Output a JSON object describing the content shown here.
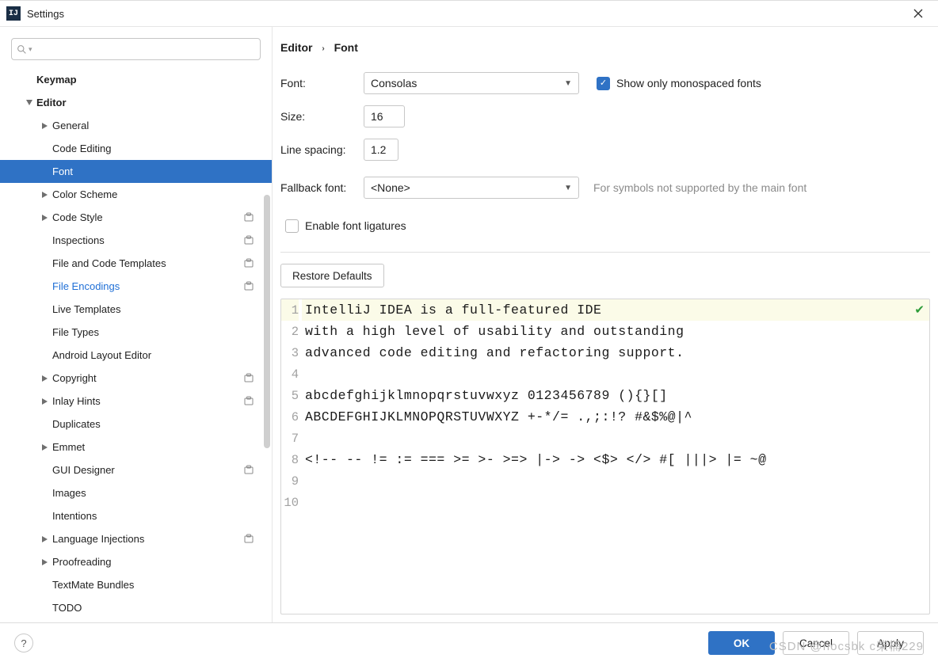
{
  "window_title": "Settings",
  "breadcrumb": {
    "root": "Editor",
    "leaf": "Font"
  },
  "sidebar": {
    "items": [
      {
        "label": "Keymap",
        "level": 0,
        "bold": true,
        "expand": null,
        "selected": false,
        "modified": false,
        "badge": false
      },
      {
        "label": "Editor",
        "level": 0,
        "bold": true,
        "expand": "down",
        "selected": false,
        "modified": false,
        "badge": false
      },
      {
        "label": "General",
        "level": 1,
        "bold": false,
        "expand": "right",
        "selected": false,
        "modified": false,
        "badge": false
      },
      {
        "label": "Code Editing",
        "level": 1,
        "bold": false,
        "expand": null,
        "selected": false,
        "modified": false,
        "badge": false
      },
      {
        "label": "Font",
        "level": 1,
        "bold": false,
        "expand": null,
        "selected": true,
        "modified": false,
        "badge": false
      },
      {
        "label": "Color Scheme",
        "level": 1,
        "bold": false,
        "expand": "right",
        "selected": false,
        "modified": false,
        "badge": false
      },
      {
        "label": "Code Style",
        "level": 1,
        "bold": false,
        "expand": "right",
        "selected": false,
        "modified": false,
        "badge": true
      },
      {
        "label": "Inspections",
        "level": 1,
        "bold": false,
        "expand": null,
        "selected": false,
        "modified": false,
        "badge": true
      },
      {
        "label": "File and Code Templates",
        "level": 1,
        "bold": false,
        "expand": null,
        "selected": false,
        "modified": false,
        "badge": true
      },
      {
        "label": "File Encodings",
        "level": 1,
        "bold": false,
        "expand": null,
        "selected": false,
        "modified": true,
        "badge": true
      },
      {
        "label": "Live Templates",
        "level": 1,
        "bold": false,
        "expand": null,
        "selected": false,
        "modified": false,
        "badge": false
      },
      {
        "label": "File Types",
        "level": 1,
        "bold": false,
        "expand": null,
        "selected": false,
        "modified": false,
        "badge": false
      },
      {
        "label": "Android Layout Editor",
        "level": 1,
        "bold": false,
        "expand": null,
        "selected": false,
        "modified": false,
        "badge": false
      },
      {
        "label": "Copyright",
        "level": 1,
        "bold": false,
        "expand": "right",
        "selected": false,
        "modified": false,
        "badge": true
      },
      {
        "label": "Inlay Hints",
        "level": 1,
        "bold": false,
        "expand": "right",
        "selected": false,
        "modified": false,
        "badge": true
      },
      {
        "label": "Duplicates",
        "level": 1,
        "bold": false,
        "expand": null,
        "selected": false,
        "modified": false,
        "badge": false
      },
      {
        "label": "Emmet",
        "level": 1,
        "bold": false,
        "expand": "right",
        "selected": false,
        "modified": false,
        "badge": false
      },
      {
        "label": "GUI Designer",
        "level": 1,
        "bold": false,
        "expand": null,
        "selected": false,
        "modified": false,
        "badge": true
      },
      {
        "label": "Images",
        "level": 1,
        "bold": false,
        "expand": null,
        "selected": false,
        "modified": false,
        "badge": false
      },
      {
        "label": "Intentions",
        "level": 1,
        "bold": false,
        "expand": null,
        "selected": false,
        "modified": false,
        "badge": false
      },
      {
        "label": "Language Injections",
        "level": 1,
        "bold": false,
        "expand": "right",
        "selected": false,
        "modified": false,
        "badge": true
      },
      {
        "label": "Proofreading",
        "level": 1,
        "bold": false,
        "expand": "right",
        "selected": false,
        "modified": false,
        "badge": false
      },
      {
        "label": "TextMate Bundles",
        "level": 1,
        "bold": false,
        "expand": null,
        "selected": false,
        "modified": false,
        "badge": false
      },
      {
        "label": "TODO",
        "level": 1,
        "bold": false,
        "expand": null,
        "selected": false,
        "modified": false,
        "badge": false
      }
    ]
  },
  "form": {
    "font_label": "Font:",
    "font_value": "Consolas",
    "mono_label": "Show only monospaced fonts",
    "mono_checked": true,
    "size_label": "Size:",
    "size_value": "16",
    "spacing_label": "Line spacing:",
    "spacing_value": "1.2",
    "fallback_label": "Fallback font:",
    "fallback_value": "<None>",
    "fallback_hint": "For symbols not supported by the main font",
    "ligatures_label": "Enable font ligatures",
    "ligatures_checked": false,
    "restore_label": "Restore Defaults"
  },
  "preview": {
    "lines": [
      "IntelliJ IDEA is a full-featured IDE",
      "with a high level of usability and outstanding",
      "advanced code editing and refactoring support.",
      "",
      "abcdefghijklmnopqrstuvwxyz 0123456789 (){}[]",
      "ABCDEFGHIJKLMNOPQRSTUVWXYZ +-*/= .,;:!? #&$%@|^",
      "",
      "<!-- -- != := === >= >- >=> |-> -> <$> </> #[ |||> |= ~@",
      "",
      ""
    ]
  },
  "footer": {
    "ok": "OK",
    "cancel": "Cancel",
    "apply": "Apply"
  },
  "watermark": "CSDN @hocsbk c柴楠229"
}
